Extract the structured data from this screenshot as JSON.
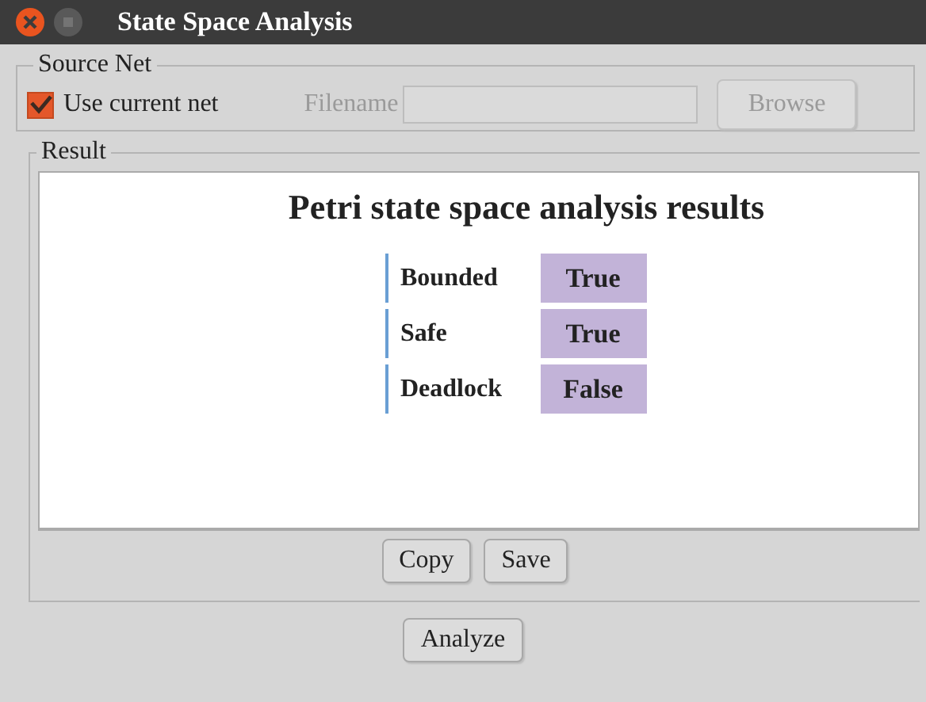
{
  "window": {
    "title": "State Space Analysis"
  },
  "source_net": {
    "legend": "Source Net",
    "use_current": {
      "label": "Use current net",
      "checked": true
    },
    "filename": {
      "label": "Filename",
      "disabled": true
    },
    "browse": {
      "label": "Browse",
      "disabled": true
    }
  },
  "result": {
    "legend": "Result",
    "heading": "Petri state space analysis results",
    "rows": [
      {
        "property": "Bounded",
        "value": "True"
      },
      {
        "property": "Safe",
        "value": "True"
      },
      {
        "property": "Deadlock",
        "value": "False"
      }
    ],
    "buttons": [
      "Copy",
      "Save"
    ]
  },
  "analyze_button": "Analyze"
}
